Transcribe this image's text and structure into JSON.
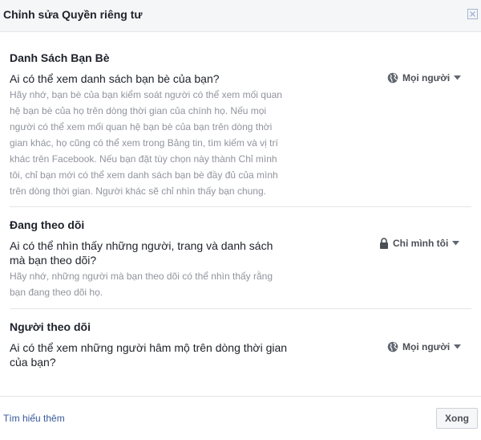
{
  "dialog": {
    "title": "Chỉnh sửa Quyền riêng tư",
    "close_icon": "close-icon"
  },
  "sections": [
    {
      "title": "Danh Sách Bạn Bè",
      "question_lines": [
        "Ai có thể xem danh sách bạn bè của bạn?"
      ],
      "description_lines": [
        "Hãy nhớ, bạn bè của bạn kiểm soát người có thể xem mối quan",
        "hệ bạn bè của họ trên dòng thời gian của chính họ. Nếu mọi",
        "người có thể xem mối quan hệ bạn bè của bạn trên dòng thời",
        "gian khác, họ cũng có thể xem trong Bảng tin, tìm kiếm và vị trí",
        "khác trên Facebook. Nếu bạn đặt tùy chọn này thành Chỉ mình",
        "tôi, chỉ bạn mới có thể xem danh sách bạn bè đầy đủ của mình",
        "trên dòng thời gian. Người khác sẽ chỉ nhìn thấy bạn chung."
      ],
      "audience": {
        "label": "Mọi người",
        "icon": "globe-icon"
      }
    },
    {
      "title": "Đang theo dõi",
      "question_lines": [
        "Ai có thể nhìn thấy những người, trang và danh sách",
        "mà bạn theo dõi?"
      ],
      "description_lines": [
        "Hãy nhớ, những người mà bạn theo dõi có thể nhìn thấy rằng",
        "bạn đang theo dõi họ."
      ],
      "audience": {
        "label": "Chỉ mình tôi",
        "icon": "lock-icon"
      }
    },
    {
      "title": "Người theo dõi",
      "question_lines": [
        "Ai có thể xem những người hâm mộ trên dòng thời gian",
        "của bạn?"
      ],
      "description_lines": [],
      "audience": {
        "label": "Mọi người",
        "icon": "globe-icon"
      }
    }
  ],
  "footer": {
    "learn_more": "Tìm hiểu thêm",
    "done_label": "Xong"
  },
  "colors": {
    "link": "#365899",
    "muted_text": "#90949c",
    "title_bar_bg": "#f5f6f7"
  }
}
